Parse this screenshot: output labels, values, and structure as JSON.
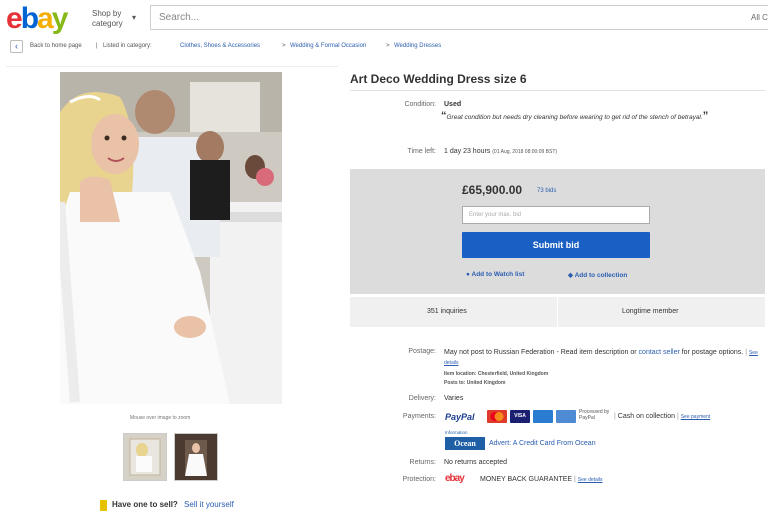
{
  "header": {
    "logo": [
      "e",
      "b",
      "a",
      "y"
    ],
    "logo_colors": [
      "#e53238",
      "#0064d2",
      "#f5af02",
      "#86b817"
    ],
    "shop_by": "Shop by",
    "category": "category",
    "search_placeholder": "Search...",
    "search_category": "All C"
  },
  "breadcrumb": {
    "back": "Back to home page",
    "listed": "Listed in category:",
    "items": [
      "Clothes, Shoes & Accessories",
      "Wedding & Formal Occasion",
      "Wedding Dresses"
    ]
  },
  "gallery": {
    "zoom_hint": "Mouse over image to zoom"
  },
  "sell": {
    "prompt": "Have one to sell?",
    "link": "Sell it yourself"
  },
  "item": {
    "title": "Art Deco Wedding Dress size 6",
    "condition_label": "Condition:",
    "condition_value": "Used",
    "condition_note": "Great condition but needs dry cleaning before wearing to get rid of the stench of betrayal.",
    "time_label": "Time left:",
    "time_value": "1 day 23 hours",
    "time_detail": "(01 Aug, 2018  08:00:09 BST)"
  },
  "bid": {
    "price": "£65,900.00",
    "bids": "73 bids",
    "max_bid_placeholder": "Enter your max. bid",
    "submit": "Submit bid",
    "watch": "Add to Watch list",
    "collection": "Add to collection"
  },
  "stats": {
    "inquiries": "351 inquiries",
    "member": "Longtime member"
  },
  "postage": {
    "label": "Postage:",
    "text": "May not post to Russian Federation - Read item description or ",
    "contact": "contact seller",
    "text2": " for postage options.",
    "details": "See details",
    "location": "Item location:  Chesterfield, United Kingdom",
    "posts_to": "Posts to:  United Kingdom"
  },
  "delivery": {
    "label": "Delivery:",
    "value": "Varies"
  },
  "payments": {
    "label": "Payments:",
    "paypal": "PayPal",
    "processed": "Processed by PayPal",
    "cash": "Cash on collection",
    "see_payment": "See payment",
    "ocean_info": "Information",
    "ocean": "Ocean",
    "advert": "Advert: A Credit Card From Ocean"
  },
  "returns": {
    "label": "Returns:",
    "value": "No returns accepted"
  },
  "protection": {
    "label": "Protection:",
    "logo": "ebay",
    "value": "MONEY BACK GUARANTEE",
    "details": "See details"
  }
}
